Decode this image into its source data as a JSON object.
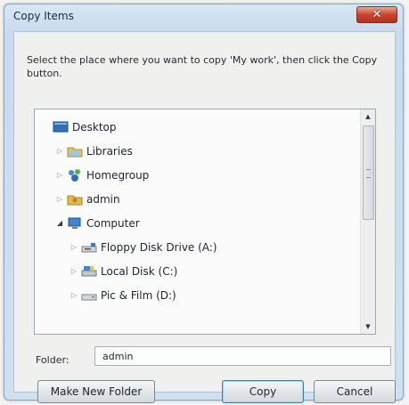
{
  "window": {
    "title": "Copy Items",
    "close_glyph": "✕",
    "instructions": "Select the place where you want to copy 'My work', then click the Copy button."
  },
  "tree": {
    "items": [
      {
        "label": "Desktop",
        "icon": "desktop-icon",
        "indent": 0,
        "arrow": ""
      },
      {
        "label": "Libraries",
        "icon": "libraries-icon",
        "indent": 1,
        "arrow": "▷"
      },
      {
        "label": "Homegroup",
        "icon": "homegroup-icon",
        "indent": 1,
        "arrow": "▷"
      },
      {
        "label": "admin",
        "icon": "user-folder-icon",
        "indent": 1,
        "arrow": "▷"
      },
      {
        "label": "Computer",
        "icon": "computer-icon",
        "indent": 1,
        "arrow": "◢"
      },
      {
        "label": "Floppy Disk Drive (A:)",
        "icon": "floppy-drive-icon",
        "indent": 2,
        "arrow": "▷"
      },
      {
        "label": "Local Disk (C:)",
        "icon": "local-disk-icon",
        "indent": 2,
        "arrow": "▷"
      },
      {
        "label": "Pic & Film (D:)",
        "icon": "disk-drive-icon",
        "indent": 2,
        "arrow": "▷"
      }
    ]
  },
  "folder": {
    "label": "Folder:",
    "value": "admin"
  },
  "buttons": {
    "new_folder": "Make New Folder",
    "copy": "Copy",
    "cancel": "Cancel"
  }
}
